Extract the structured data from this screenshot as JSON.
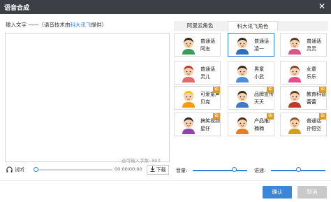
{
  "window": {
    "title": "语音合成",
    "close_icon": "close-icon"
  },
  "input": {
    "label_prefix": "输入文字 ——（语音技术由",
    "label_brand": "科大讯飞",
    "label_suffix": "提供）",
    "value": "",
    "remain_label": "还可输入字数:",
    "remain_count": "800"
  },
  "player": {
    "listen_label": "试听",
    "listen_icon": "headphones-icon",
    "time": "00:00/00:00",
    "download_label": "下载",
    "download_icon": "download-icon",
    "progress": 0
  },
  "tabs": [
    {
      "label": "阿里云角色",
      "active": false
    },
    {
      "label": "科大讯飞角色",
      "active": true
    }
  ],
  "voices": [
    {
      "line1": "普通话",
      "line2": "阿志",
      "avatar": "boy-avatar-icon",
      "vip": false,
      "selected": false
    },
    {
      "line1": "普通话",
      "line2": "凌一",
      "avatar": "man-glasses-avatar-icon",
      "vip": false,
      "selected": true
    },
    {
      "line1": "普通话",
      "line2": "灵灵",
      "avatar": "girl-glasses-avatar-icon",
      "vip": false,
      "selected": false
    },
    {
      "line1": "普通话",
      "line2": "灵儿",
      "avatar": "girl-red-hair-avatar-icon",
      "vip": false,
      "selected": false
    },
    {
      "line1": "男童",
      "line2": "小武",
      "avatar": "little-boy-avatar-icon",
      "vip": false,
      "selected": false
    },
    {
      "line1": "女童",
      "line2": "乐乐",
      "avatar": "little-girl-avatar-icon",
      "vip": false,
      "selected": false
    },
    {
      "line1": "可爱童声",
      "line2": "贝克",
      "avatar": "cute-creature-avatar-icon",
      "vip": true,
      "selected": false
    },
    {
      "line1": "品牌宣传",
      "line2": "天天",
      "avatar": "brand-host-avatar-icon",
      "vip": true,
      "selected": false
    },
    {
      "line1": "教育科普",
      "line2": "蕾蕾",
      "avatar": "teacher-avatar-icon",
      "vip": true,
      "selected": false
    },
    {
      "line1": "搞笑视频",
      "line2": "星仔",
      "avatar": "funny-boy-avatar-icon",
      "vip": true,
      "selected": false
    },
    {
      "line1": "产品推广",
      "line2": "楠楠",
      "avatar": "promo-girl-avatar-icon",
      "vip": true,
      "selected": false
    },
    {
      "line1": "普通话",
      "line2": "孙悟空",
      "avatar": "monkey-king-avatar-icon",
      "vip": true,
      "selected": false
    }
  ],
  "vip_badge": "铂",
  "volume": {
    "label": "音量:",
    "value": 0.75
  },
  "speed": {
    "label": "语速:",
    "value": 0.5
  },
  "buttons": {
    "ok": "确认",
    "cancel": "取消"
  },
  "colors": {
    "accent": "#3b86d6",
    "titlebar": "#3c3f45",
    "vip": "#d79b2a"
  }
}
